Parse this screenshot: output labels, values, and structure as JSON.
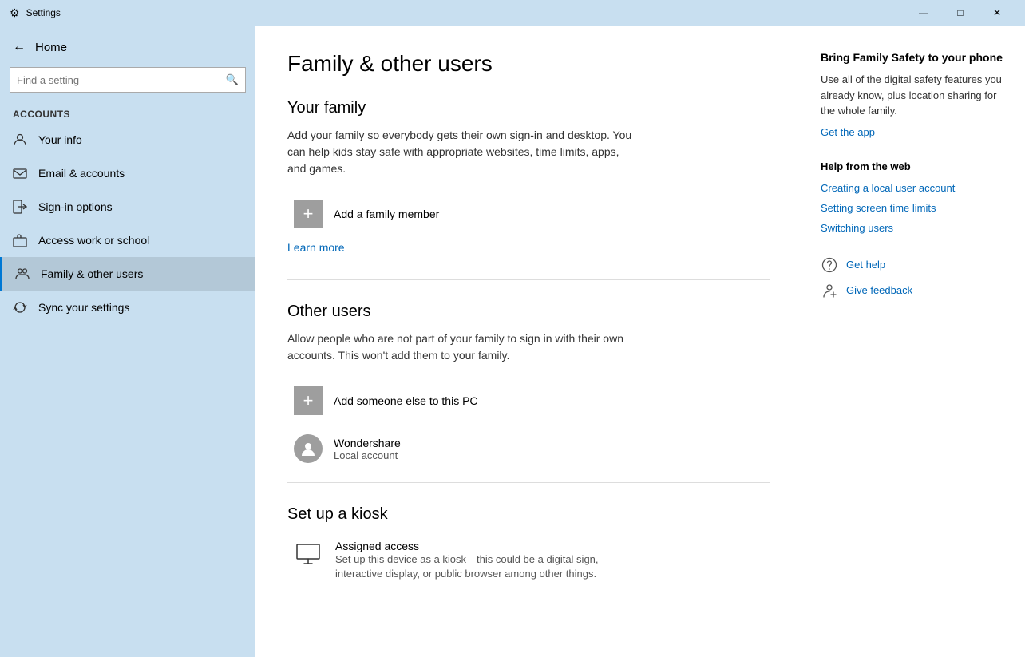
{
  "titlebar": {
    "title": "Settings",
    "minimize_label": "—",
    "maximize_label": "□",
    "close_label": "✕"
  },
  "sidebar": {
    "home_label": "Home",
    "search_placeholder": "Find a setting",
    "section_label": "Accounts",
    "items": [
      {
        "id": "your-info",
        "label": "Your info",
        "icon": "person"
      },
      {
        "id": "email-accounts",
        "label": "Email & accounts",
        "icon": "email"
      },
      {
        "id": "sign-in-options",
        "label": "Sign-in options",
        "icon": "signin"
      },
      {
        "id": "access-work-school",
        "label": "Access work or school",
        "icon": "briefcase"
      },
      {
        "id": "family-other-users",
        "label": "Family & other users",
        "icon": "family",
        "active": true
      },
      {
        "id": "sync-your-settings",
        "label": "Sync your settings",
        "icon": "sync"
      }
    ]
  },
  "main": {
    "page_title": "Family & other users",
    "your_family": {
      "section_title": "Your family",
      "description": "Add your family so everybody gets their own sign-in and desktop. You can help kids stay safe with appropriate websites, time limits, apps, and games.",
      "add_button_label": "Add a family member",
      "learn_more": "Learn more"
    },
    "other_users": {
      "section_title": "Other users",
      "description": "Allow people who are not part of your family to sign in with their own accounts. This won't add them to your family.",
      "add_button_label": "Add someone else to this PC",
      "users": [
        {
          "name": "Wondershare",
          "type": "Local account"
        }
      ]
    },
    "kiosk": {
      "section_title": "Set up a kiosk",
      "assigned_access_title": "Assigned access",
      "assigned_access_desc": "Set up this device as a kiosk—this could be a digital sign, interactive display, or public browser among other things."
    }
  },
  "right_panel": {
    "bring_family_title": "Bring Family Safety to your phone",
    "bring_family_desc": "Use all of the digital safety features you already know, plus location sharing for the whole family.",
    "get_app_link": "Get the app",
    "help_from_web_title": "Help from the web",
    "web_links": [
      {
        "label": "Creating a local user account"
      },
      {
        "label": "Setting screen time limits"
      },
      {
        "label": "Switching users"
      }
    ],
    "get_help_label": "Get help",
    "give_feedback_label": "Give feedback"
  }
}
